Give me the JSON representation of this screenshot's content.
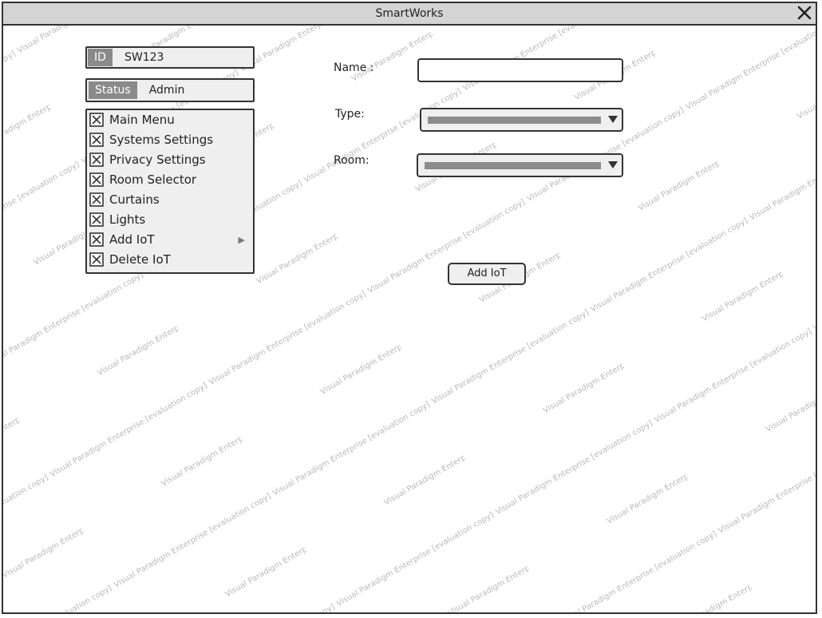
{
  "window": {
    "title": "SmartWorks"
  },
  "user": {
    "id_label": "ID",
    "id_value": "SW123",
    "status_label": "Status",
    "status_value": "Admin"
  },
  "menu": {
    "items": [
      {
        "label": "Main Menu"
      },
      {
        "label": "Systems Settings"
      },
      {
        "label": "Privacy Settings"
      },
      {
        "label": "Room Selector"
      },
      {
        "label": "Curtains"
      },
      {
        "label": "Lights"
      },
      {
        "label": "Add IoT",
        "submenu": true
      },
      {
        "label": "Delete IoT"
      }
    ]
  },
  "form": {
    "name_label": "Name :",
    "name_value": "",
    "type_label": "Type:",
    "type_value": "",
    "room_label": "Room:",
    "room_value": "",
    "submit_label": "Add IoT"
  },
  "watermark_text": "Visual Paradigm Enterprise [evaluation copy]",
  "colors": {
    "tag_bg": "#8a8a8a",
    "panel_bg": "#efefef",
    "titlebar_bg": "#d4d4d4"
  }
}
